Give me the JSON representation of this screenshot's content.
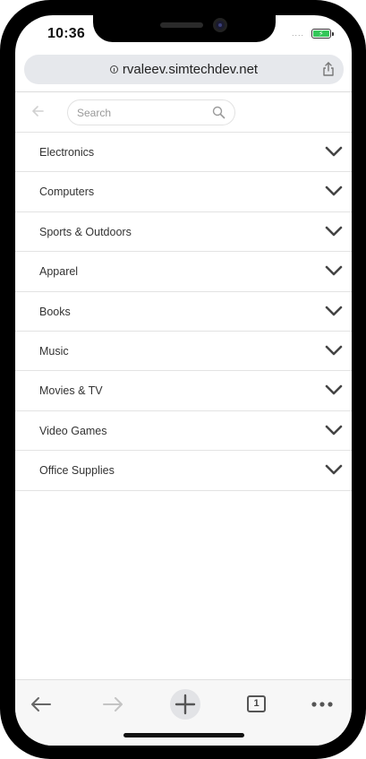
{
  "status_bar": {
    "time": "10:36",
    "signal": "....",
    "battery_color": "#34c759"
  },
  "browser": {
    "url": "rvaleev.simtechdev.net",
    "icons": {
      "info": "info-icon",
      "share": "share-icon"
    }
  },
  "page": {
    "search": {
      "placeholder": "Search",
      "value": ""
    },
    "categories": [
      {
        "label": "Electronics"
      },
      {
        "label": "Computers"
      },
      {
        "label": "Sports & Outdoors"
      },
      {
        "label": "Apparel"
      },
      {
        "label": "Books"
      },
      {
        "label": "Music"
      },
      {
        "label": "Movies & TV"
      },
      {
        "label": "Video Games"
      },
      {
        "label": "Office Supplies"
      }
    ]
  },
  "toolbar": {
    "tab_count": "1",
    "icons": [
      "back-arrow-icon",
      "forward-arrow-icon",
      "plus-icon",
      "tabs-icon",
      "more-icon"
    ]
  },
  "colors": {
    "text": "#333333",
    "divider": "#e3e3e3",
    "url_bar_bg": "#e6e8ec"
  }
}
